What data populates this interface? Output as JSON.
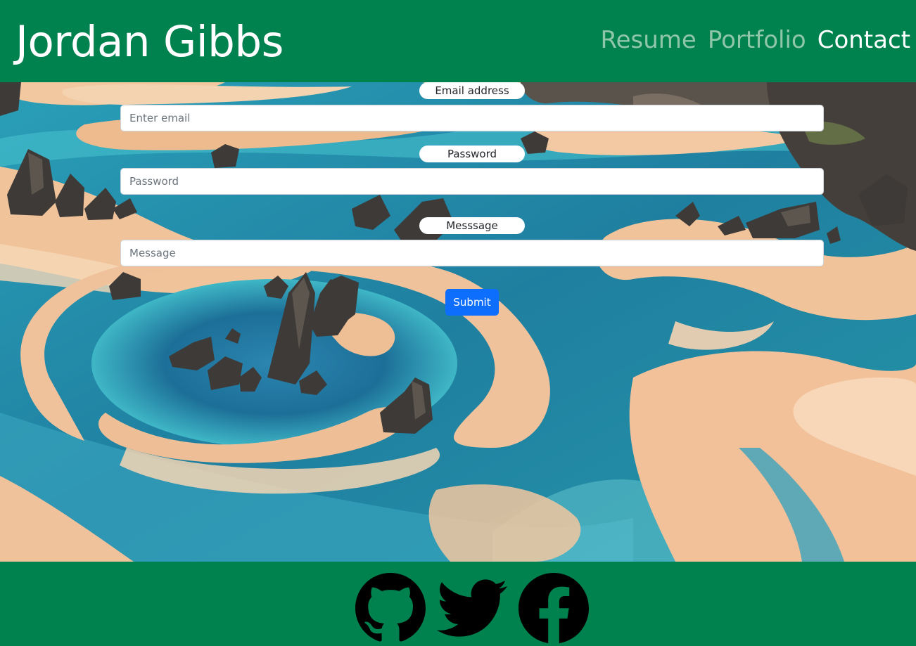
{
  "header": {
    "brand": "Jordan Gibbs",
    "nav": [
      {
        "label": "Resume",
        "active": false
      },
      {
        "label": "Portfolio",
        "active": false
      },
      {
        "label": "Contact",
        "active": true
      }
    ]
  },
  "form": {
    "email_label": "Email address",
    "email_placeholder": "Enter email",
    "password_label": "Password",
    "password_placeholder": "Password",
    "message_label": "Messsage",
    "message_placeholder": "Message",
    "submit_label": "Submit"
  },
  "footer": {
    "icons": [
      "github-icon",
      "twitter-icon",
      "facebook-icon"
    ]
  },
  "colors": {
    "header_bg": "#00824f",
    "nav_active": "#ffffff",
    "nav_inactive": "#8fc6a8",
    "submit_bg": "#0d6efd"
  }
}
